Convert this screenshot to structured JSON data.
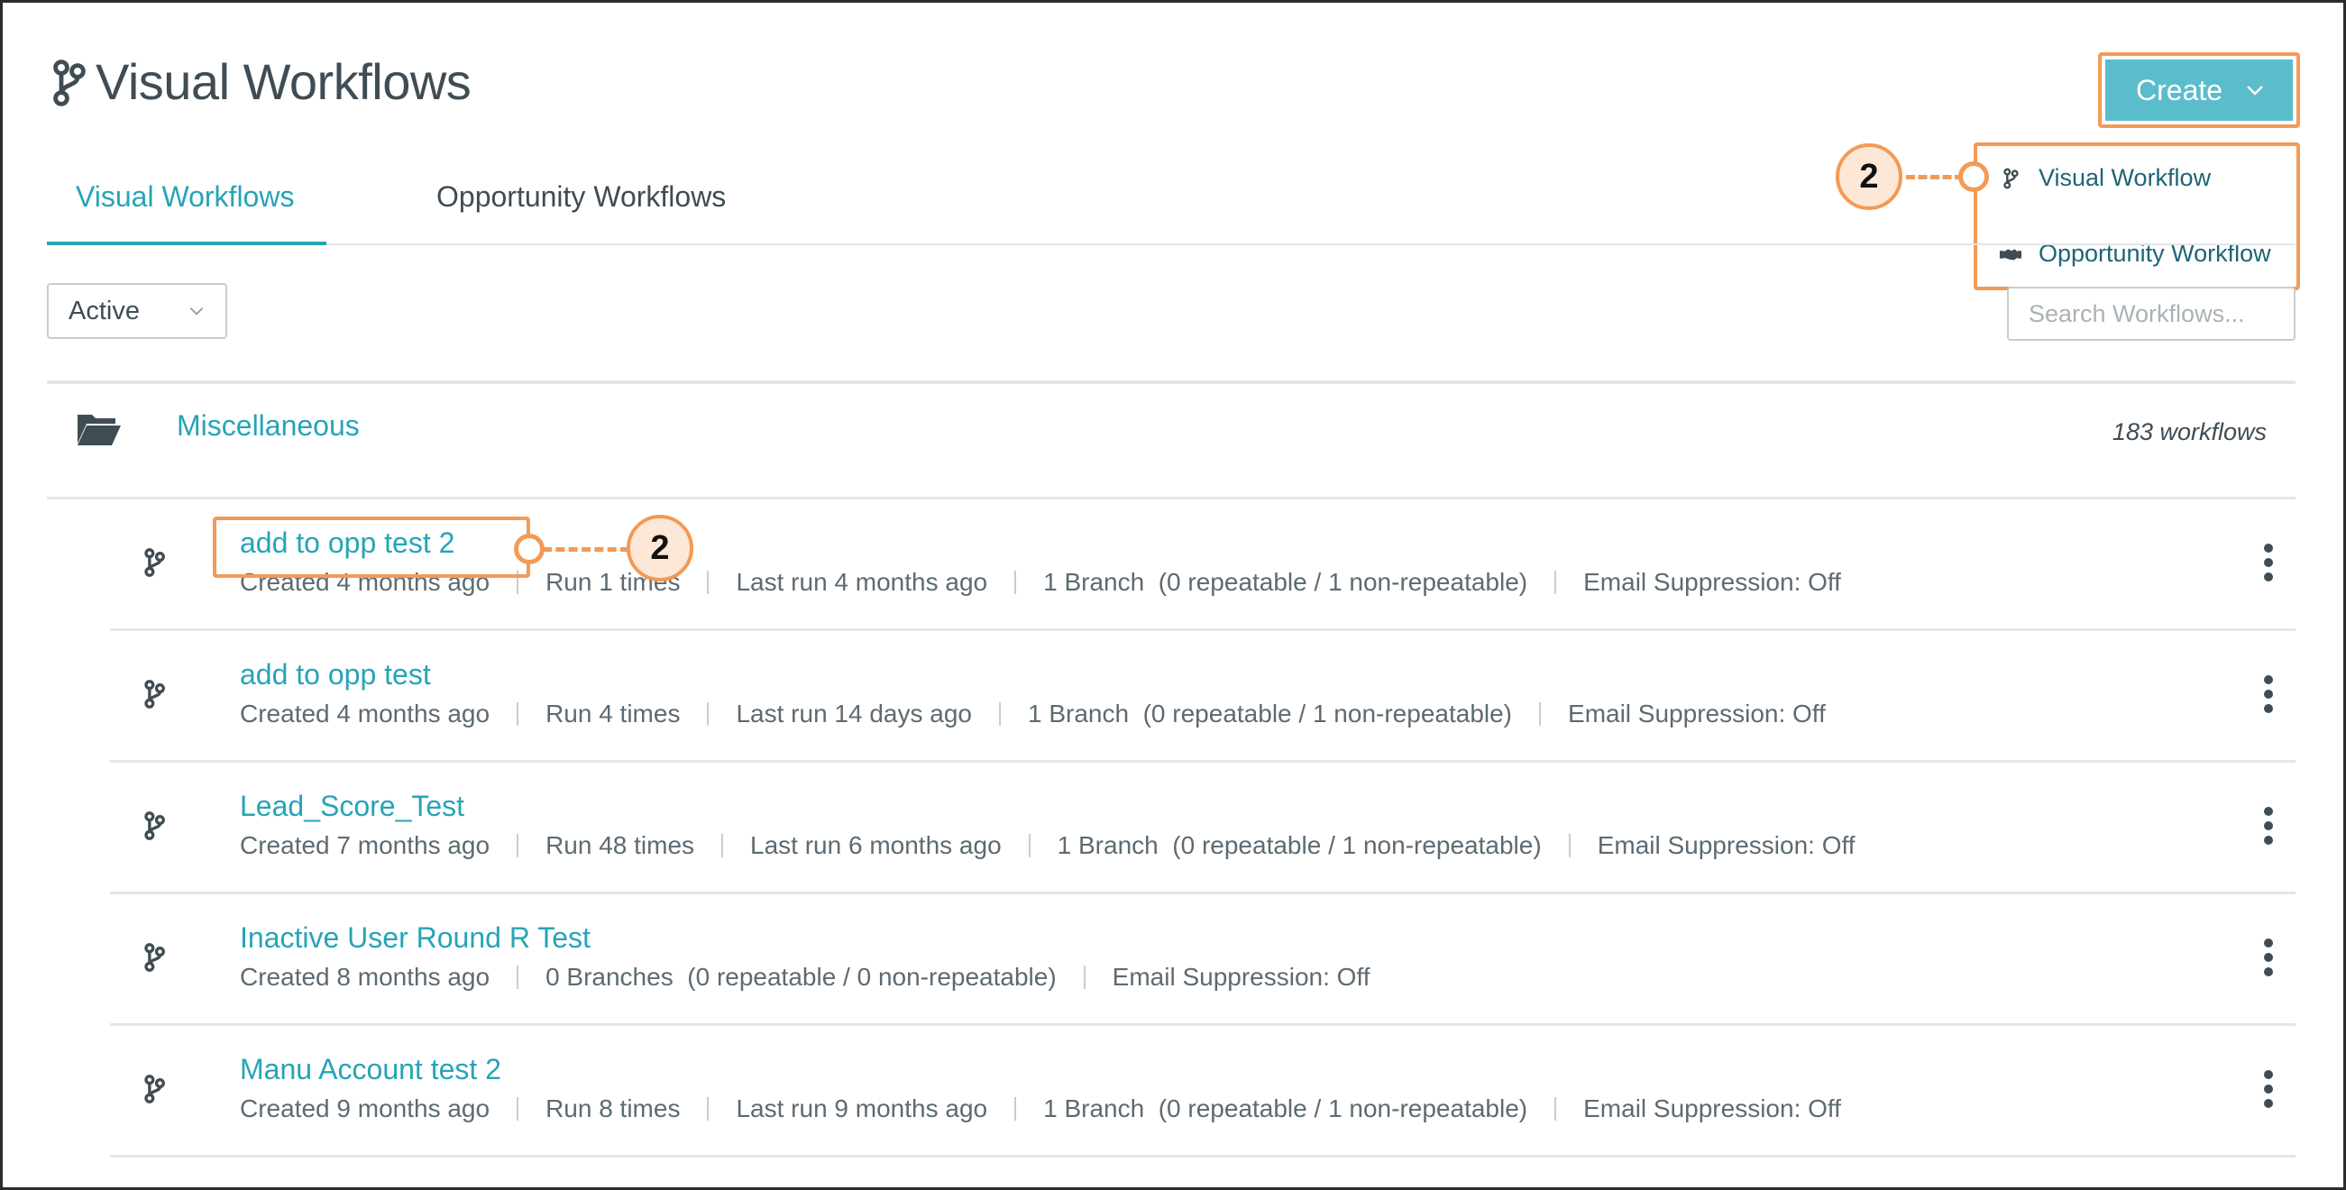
{
  "page": {
    "title": "Visual Workflows"
  },
  "tabs": [
    {
      "label": "Visual Workflows",
      "active": true
    },
    {
      "label": "Opportunity Workflows",
      "active": false
    }
  ],
  "filter": {
    "status_value": "Active"
  },
  "search": {
    "placeholder": "Search Workflows..."
  },
  "create": {
    "label": "Create",
    "menu": [
      {
        "label": "Visual Workflow",
        "icon": "workflow-icon"
      },
      {
        "label": "Opportunity Workflow",
        "icon": "handshake-icon"
      }
    ]
  },
  "callouts": {
    "step": "2"
  },
  "folder": {
    "name": "Miscellaneous",
    "count": "183 workflows"
  },
  "workflows": [
    {
      "name": "add to opp test 2",
      "meta": [
        "Created 4 months ago",
        "Run 1 times",
        "Last run 4 months ago",
        "1 Branch  (0 repeatable / 1 non-repeatable)",
        "Email Suppression: Off"
      ]
    },
    {
      "name": "add to opp test",
      "meta": [
        "Created 4 months ago",
        "Run 4 times",
        "Last run 14 days ago",
        "1 Branch  (0 repeatable / 1 non-repeatable)",
        "Email Suppression: Off"
      ]
    },
    {
      "name": "Lead_Score_Test",
      "meta": [
        "Created 7 months ago",
        "Run 48 times",
        "Last run 6 months ago",
        "1 Branch  (0 repeatable / 1 non-repeatable)",
        "Email Suppression: Off"
      ]
    },
    {
      "name": "Inactive User Round R Test",
      "meta": [
        "Created 8 months ago",
        "0 Branches  (0 repeatable / 0 non-repeatable)",
        "Email Suppression: Off"
      ]
    },
    {
      "name": "Manu Account test 2",
      "meta": [
        "Created 9 months ago",
        "Run 8 times",
        "Last run 9 months ago",
        "1 Branch  (0 repeatable / 1 non-repeatable)",
        "Email Suppression: Off"
      ]
    }
  ],
  "colors": {
    "accent": "#26a4b7",
    "create_bg": "#5bbccc",
    "highlight": "#f39a55",
    "menu_link": "#1d6577"
  }
}
